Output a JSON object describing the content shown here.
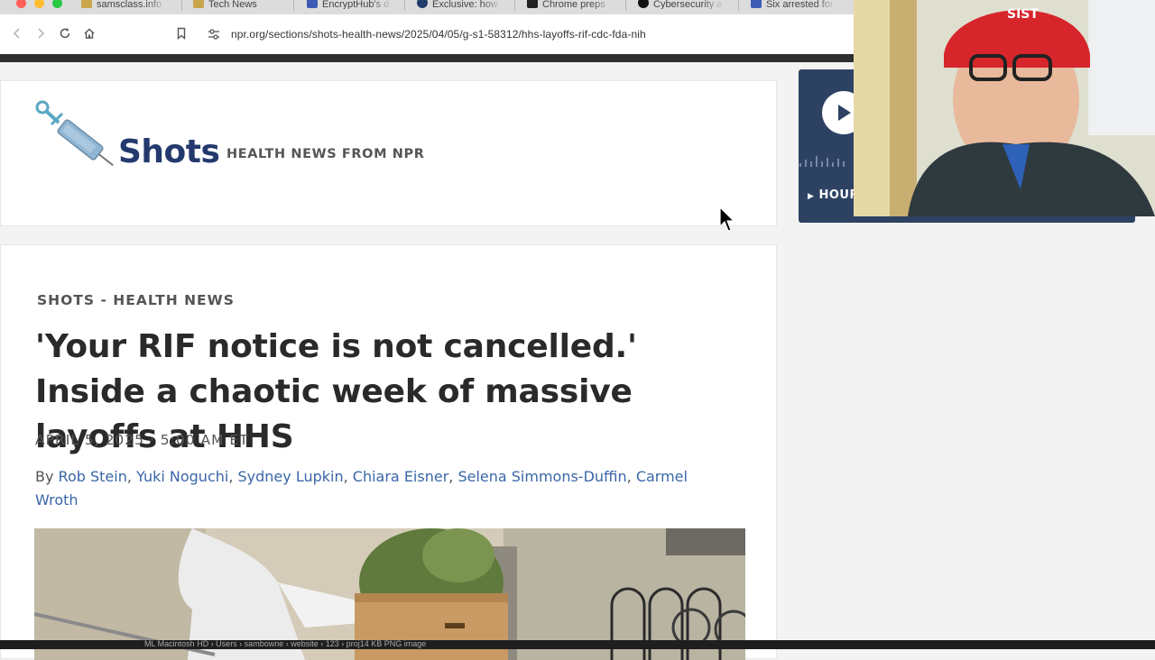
{
  "browser": {
    "tabs": [
      {
        "title": "samsclass.info",
        "color": "#c9a64b"
      },
      {
        "title": "Tech News",
        "color": "#c9a64b"
      },
      {
        "title": "EncryptHub's d",
        "color": "#3d5bb5"
      },
      {
        "title": "Exclusive: how",
        "color": "#1f3c6b"
      },
      {
        "title": "Chrome preps",
        "color": "#222222"
      },
      {
        "title": "Cybersecurity a",
        "color": "#111111"
      },
      {
        "title": "Six arrested for",
        "color": "#3d5bb5"
      }
    ],
    "url": "npr.org/sections/shots-health-news/2025/04/05/g-s1-58312/hhs-layoffs-rif-cdc-fda-nih",
    "icons": {
      "back": "chevron-left-icon",
      "forward": "chevron-right-icon",
      "reload": "reload-icon",
      "home": "home-icon",
      "bookmark": "bookmark-icon",
      "site_info": "tune-icon"
    }
  },
  "header": {
    "logo_text": "Shots",
    "tagline": "HEALTH NEWS FROM NPR"
  },
  "article": {
    "section": "SHOTS - HEALTH NEWS",
    "headline": "'Your RIF notice is not cancelled.' Inside a chaotic week of massive layoffs at HHS",
    "date": "APRIL 5, 2025 · 5:00 AM ET",
    "by_prefix": "By",
    "authors": [
      "Rob Stein",
      "Yuki Noguchi",
      "Sydney Lupkin",
      "Chiara Eisner",
      "Selena Simmons-Duffin",
      "Carmel Wroth"
    ]
  },
  "sidebar": {
    "player_label": "HOUR",
    "accent": "#2d4263"
  },
  "statusbar": {
    "path": "ML    Macintosh HD  ›  Users  ›  sambowne  ›  website  ›  123  ›  proj14          KB  PNG image"
  },
  "colors": {
    "link": "#3a66a8",
    "headline": "#2a2a2a",
    "logo": "#243a6e"
  }
}
